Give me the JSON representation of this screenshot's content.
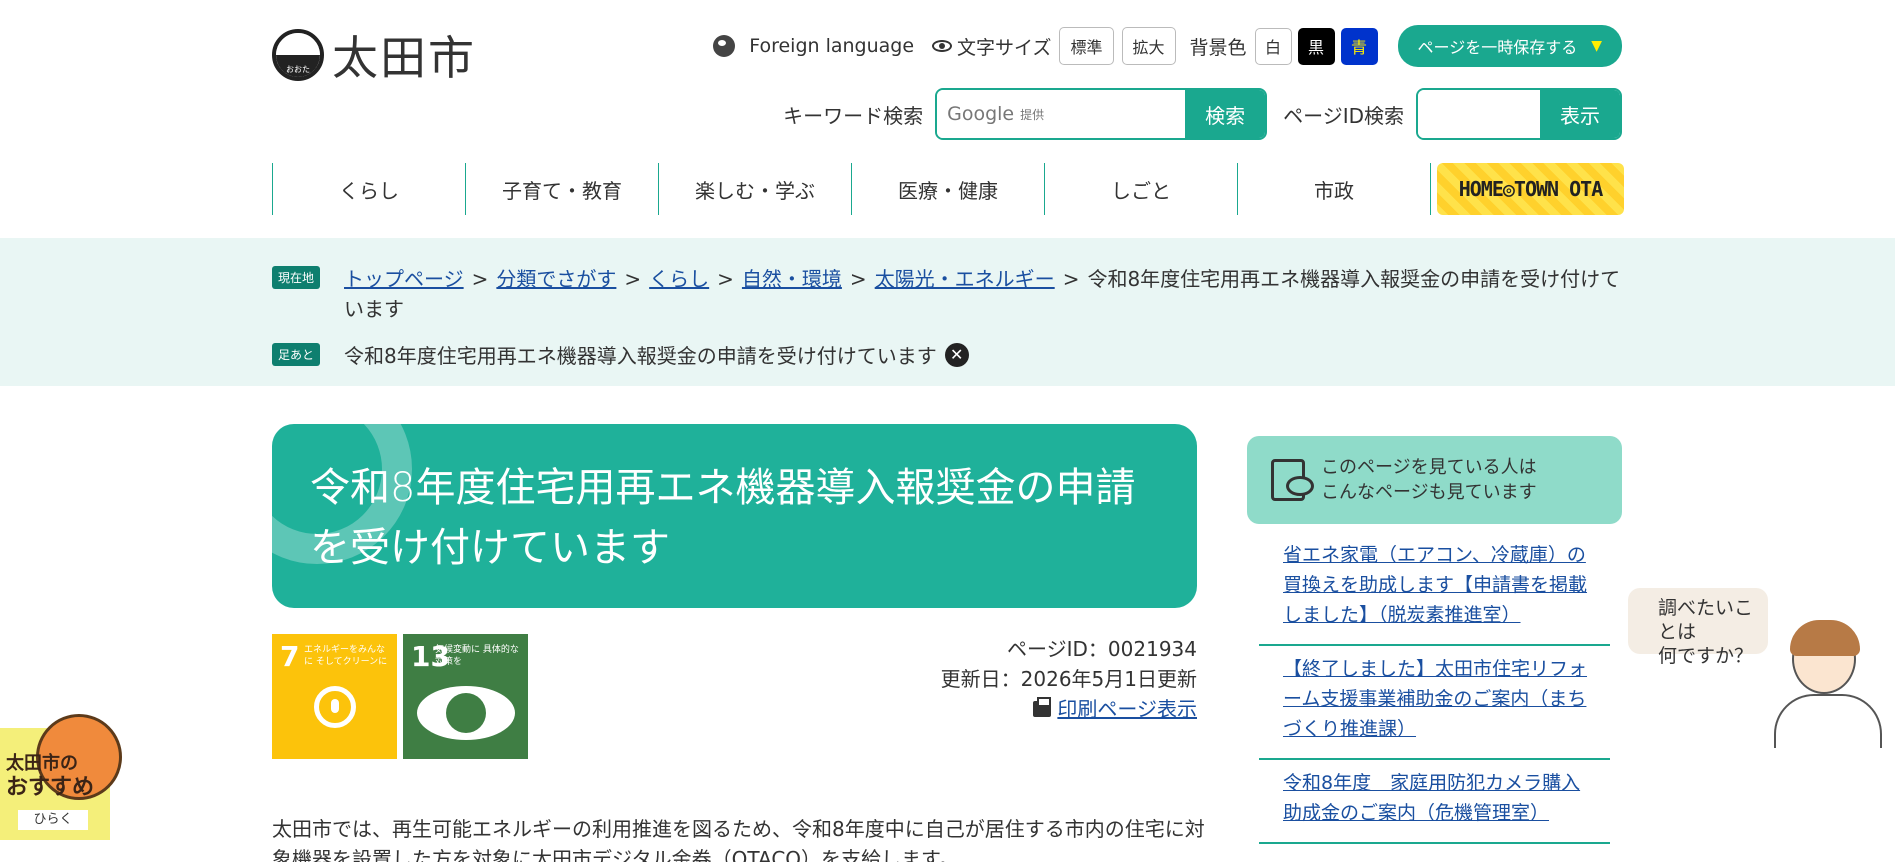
{
  "header": {
    "logo_text": "太田市",
    "logo_kana": "おおた",
    "foreign_language": "Foreign language",
    "text_size_label": "文字サイズ",
    "text_size_normal": "標準",
    "text_size_large": "拡大",
    "bg_color_label": "背景色",
    "bg_white": "白",
    "bg_black": "黒",
    "bg_blue": "青",
    "save_page": "ページを一時保存する",
    "keyword_search_label": "キーワード検索",
    "google_label": "Google",
    "google_provided": "提供",
    "search_button": "検索",
    "page_id_search_label": "ページID検索",
    "display_button": "表示"
  },
  "nav": {
    "items": [
      "くらし",
      "子育て・教育",
      "楽しむ・学ぶ",
      "医療・健康",
      "しごと",
      "市政"
    ],
    "hometown": "HOME◎TOWN OTA"
  },
  "breadcrumb": {
    "current_tag": "現在地",
    "links": [
      "トップページ",
      "分類でさがす",
      "くらし",
      "自然・環境",
      "太陽光・エネルギー"
    ],
    "current": "令和8年度住宅用再エネ機器導入報奨金の申請を受け付けています",
    "footprint_tag": "足あと",
    "footprint_item": "令和8年度住宅用再エネ機器導入報奨金の申請を受け付けています"
  },
  "main": {
    "title": "令和8年度住宅用再エネ機器導入報奨金の申請を受け付けています",
    "page_id": "ページID：0021934",
    "updated": "更新日：2026年5月1日更新",
    "print_link": "印刷ページ表示",
    "body": "太田市では、再生可能エネルギーの利用推進を図るため、令和8年度中に自己が居住する市内の住宅に対象機器を設置した方を対象に太田市デジタル金券（OTACO）を支給します。",
    "sdg7_num": "7",
    "sdg7_caption": "エネルギーをみんなに そしてクリーンに",
    "sdg13_num": "13",
    "sdg13_caption": "気候変動に 具体的な対策を"
  },
  "sidebar": {
    "heading_line1": "このページを見ている人は",
    "heading_line2": "こんなページも見ています",
    "links": [
      "省エネ家電（エアコン、冷蔵庫）の買換えを助成します【申請書を掲載しました】（脱炭素推進室）",
      "【終了しました】太田市住宅リフォーム支援事業補助金のご案内（まちづくり推進課）",
      "令和8年度　家庭用防犯カメラ購入助成金のご案内（危機管理室）"
    ]
  },
  "help": {
    "line1": "調べたいことは",
    "line2": "何ですか？"
  },
  "recommend": {
    "line1": "太田市の",
    "line2": "おすすめ",
    "open": "ひらく"
  },
  "colors": {
    "accent": "#1aa88f",
    "title_bg": "#1fb19a",
    "crumb_bg": "#e9f6f4",
    "link": "#1a4fa0"
  }
}
